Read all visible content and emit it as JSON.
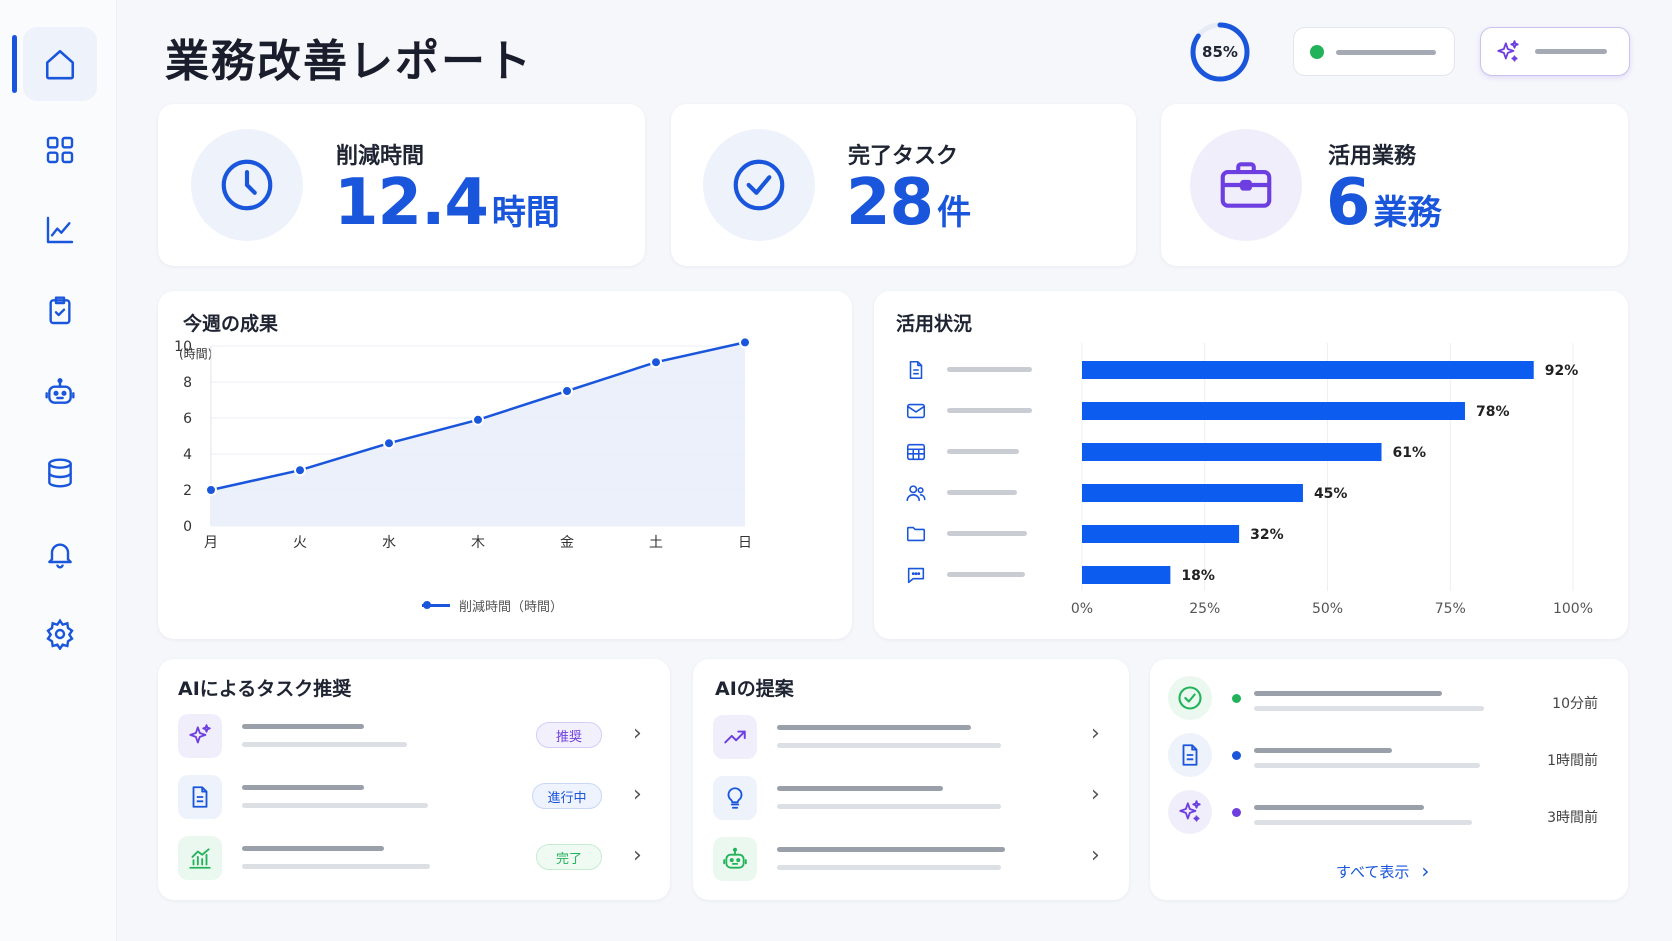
{
  "page": {
    "title": "業務改善レポート"
  },
  "header": {
    "progress_label": "85%",
    "progress_value": 0.85
  },
  "stats": [
    {
      "label": "削減時間",
      "value": "12.4",
      "unit": "時間",
      "icon": "clock-icon"
    },
    {
      "label": "完了タスク",
      "value": "28",
      "unit": "件",
      "icon": "check-circle-icon"
    },
    {
      "label": "活用業務",
      "value": "6",
      "unit": "業務",
      "icon": "briefcase-icon"
    }
  ],
  "weekly": {
    "title": "今週の成果",
    "y_unit": "(時間)",
    "legend": "削減時間（時間）"
  },
  "usage": {
    "title": "活用状況"
  },
  "tasks": {
    "title": "AIによるタスク推奨",
    "badges": [
      "推奨",
      "進行中",
      "完了"
    ]
  },
  "proposals": {
    "title": "AIの提案"
  },
  "activity": {
    "times": [
      "10分前",
      "1時間前",
      "3時間前"
    ],
    "view_all": "すべて表示"
  },
  "chart_data": [
    {
      "type": "line",
      "title": "今週の成果",
      "x": [
        "月",
        "火",
        "水",
        "木",
        "金",
        "土",
        "日"
      ],
      "series": [
        {
          "name": "削減時間（時間）",
          "values": [
            2.0,
            3.1,
            4.6,
            5.9,
            7.5,
            9.1,
            10.2
          ]
        }
      ],
      "ylabel": "(時間)",
      "ylim": [
        0,
        10
      ],
      "yticks": [
        "0",
        "2",
        "4",
        "6",
        "8",
        "10"
      ],
      "grid": true,
      "legend": "bottom"
    },
    {
      "type": "bar",
      "orientation": "horizontal",
      "title": "活用状況",
      "categories": [
        "document",
        "mail",
        "table",
        "users",
        "folder",
        "chat"
      ],
      "values": [
        92,
        78,
        61,
        45,
        32,
        18
      ],
      "value_labels": [
        "92%",
        "78%",
        "61%",
        "45%",
        "32%",
        "18%"
      ],
      "xlim": [
        0,
        100
      ],
      "xticks": [
        "0%",
        "25%",
        "50%",
        "75%",
        "100%"
      ],
      "grid": true
    }
  ],
  "colors": {
    "accent": "#1a56db",
    "bar": "#0d5cf0",
    "purple": "#6d3fe0",
    "green": "#22b35a"
  }
}
